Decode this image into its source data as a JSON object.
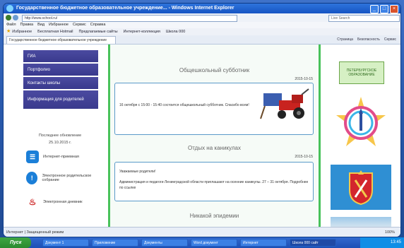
{
  "window": {
    "title": "Государственное бюджетное образовательное учреждение... - Windows Internet Explorer"
  },
  "address": {
    "url": "http://www.school.ru/",
    "search_placeholder": "Live Search"
  },
  "menu": [
    "Файл",
    "Правка",
    "Вид",
    "Избранное",
    "Сервис",
    "Справка"
  ],
  "favorites": [
    "Избранное",
    "Бесплатная Hotmail",
    "Предлагаемые сайты",
    "Интернет-коллекция",
    "Школа 000"
  ],
  "tab": {
    "label": "Государственное бюджетное образовательное учреждение"
  },
  "toolbar": [
    "Страница",
    "Безопасность",
    "Сервис"
  ],
  "sidebar": {
    "items": [
      {
        "label": "ГИА"
      },
      {
        "label": "Портфолио"
      },
      {
        "label": "Контакты школы"
      },
      {
        "label": "Информация для родителей"
      }
    ],
    "updated_title": "Последнее обновление",
    "updated_date": "25.10.2015 г.",
    "services": [
      {
        "label": "Интернет-приемная",
        "icon": "chat-icon"
      },
      {
        "label": "Электронное родительское собрание",
        "icon": "alert-icon"
      },
      {
        "label": "Электронная дневник",
        "icon": "fire-icon"
      }
    ]
  },
  "news": [
    {
      "title": "Общешкольный субботник",
      "date": "2015-10-15",
      "text": "16 октября с 15:00 - 15:40 состоится общешкольный субботник. Спасибо всем!"
    },
    {
      "title": "Отдых на каникулах",
      "date": "2015-10-15",
      "text_head": "Уважаемые родители!",
      "text": "Администрация и педагоги Ленинградской области приглашают на осенние каникулы. 27 – 31 октября. Подробнее по ссылке"
    },
    {
      "title": "Никакой эпидемии"
    }
  ],
  "right": {
    "logo_text": "ПЕТЕРБУРГСКОЕ ОБРАЗОВАНИЕ"
  },
  "status": {
    "left": "Интернет | Защищенный режим",
    "zoom": "100%"
  },
  "taskbar": {
    "start": "Пуск",
    "tasks": [
      "Документ 1",
      "Приложение",
      "Документы",
      "Word документ",
      "Интернет",
      "Школа 000 сайт"
    ],
    "clock": "13:45"
  },
  "colors": {
    "accent_green": "#48c25a",
    "nav_purple": "#3a3a8d",
    "title_blue": "#1654c3"
  }
}
